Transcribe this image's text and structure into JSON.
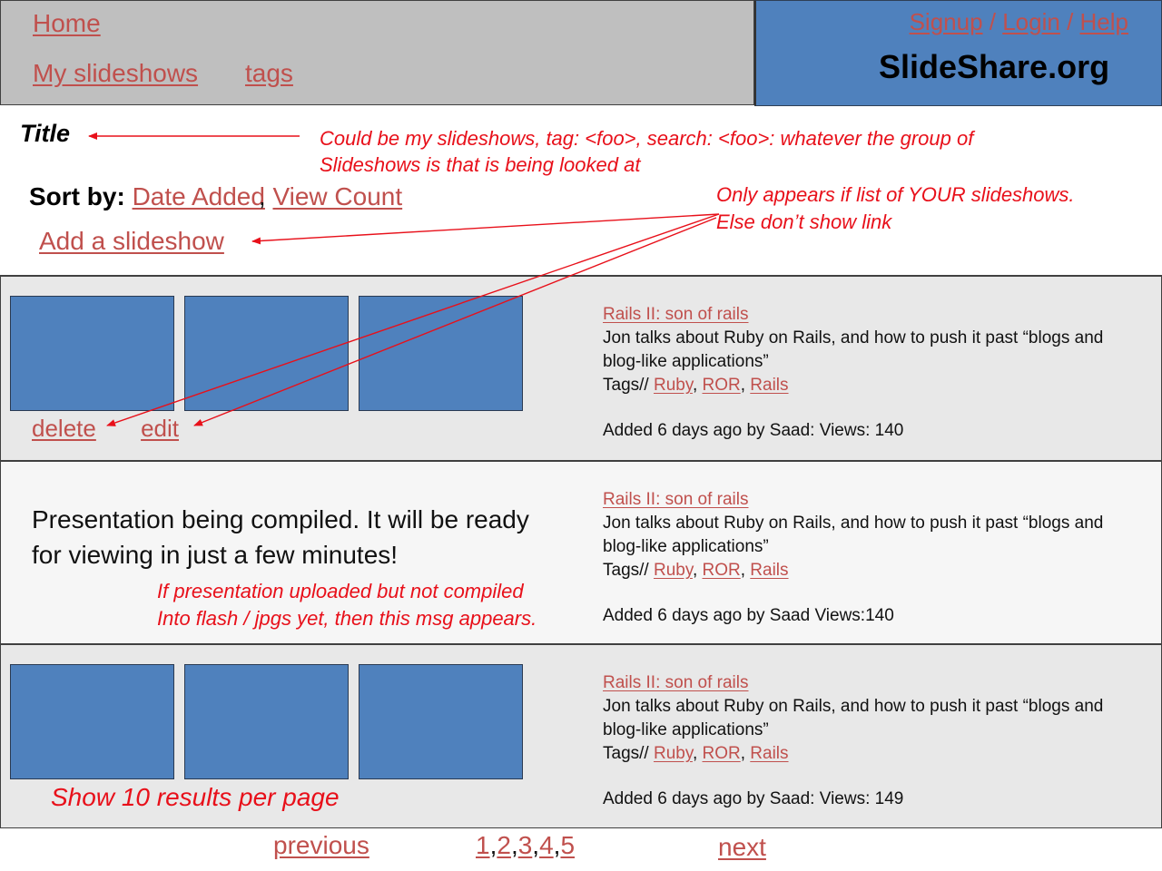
{
  "header": {
    "nav": {
      "home": "Home",
      "my_slideshows": "My slideshows",
      "tags": "tags"
    },
    "auth": {
      "signup": "Signup",
      "login": "Login",
      "help": "Help",
      "separator": " / "
    },
    "brand": "SlideShare.org"
  },
  "page": {
    "title": "Title",
    "sort_label": "Sort by:",
    "sort_options": [
      "Date Added",
      "View Count"
    ],
    "sort_separator": ", ",
    "add_slideshow": "Add a slideshow"
  },
  "annotations": {
    "title_note_line1": "Could be my slideshows, tag: <foo>, search: <foo>: whatever the group of",
    "title_note_line2": "Slideshows is that is being looked at",
    "own_note_line1": "Only appears if list of YOUR slideshows.",
    "own_note_line2": "Else don’t show link",
    "compile_note_line1": "If presentation uploaded but not compiled",
    "compile_note_line2": "Into flash / jpgs yet, then this msg appears.",
    "perpage_note": "Show 10 results per page"
  },
  "rows": [
    {
      "title": "Rails II: son of rails",
      "description": "Jon talks about Ruby on Rails, and how to push it past “blogs and blog-like applications”",
      "tags_label": "Tags// ",
      "tags": [
        "Ruby",
        "ROR",
        "Rails"
      ],
      "meta": "Added 6 days ago by  Saad: Views: 140",
      "actions": {
        "delete": "delete",
        "edit": "edit"
      }
    },
    {
      "title": "Rails II: son of rails",
      "description": "Jon talks about Ruby on Rails, and how to push it past “blogs and blog-like applications”",
      "tags_label": "Tags// ",
      "tags": [
        "Ruby",
        "ROR",
        "Rails"
      ],
      "meta": "Added 6 days ago by Saad Views:140",
      "compile_message": "Presentation being compiled. It will be ready for viewing in just a few minutes!"
    },
    {
      "title": "Rails II: son of rails",
      "description": "Jon talks about Ruby on Rails, and how to push it past “blogs and blog-like applications”",
      "tags_label": "Tags// ",
      "tags": [
        "Ruby",
        "ROR",
        "Rails"
      ],
      "meta": "Added 6 days ago by Saad: Views: 149"
    }
  ],
  "pagination": {
    "previous": "previous",
    "pages": [
      "1",
      "2",
      "3",
      "4",
      "5"
    ],
    "next": "next"
  },
  "colors": {
    "link": "#c0504d",
    "annotation": "#e8101a",
    "brand_bg": "#4f81bd",
    "nav_bg": "#bfbfbf",
    "thumbnail": "#4f81bd"
  }
}
